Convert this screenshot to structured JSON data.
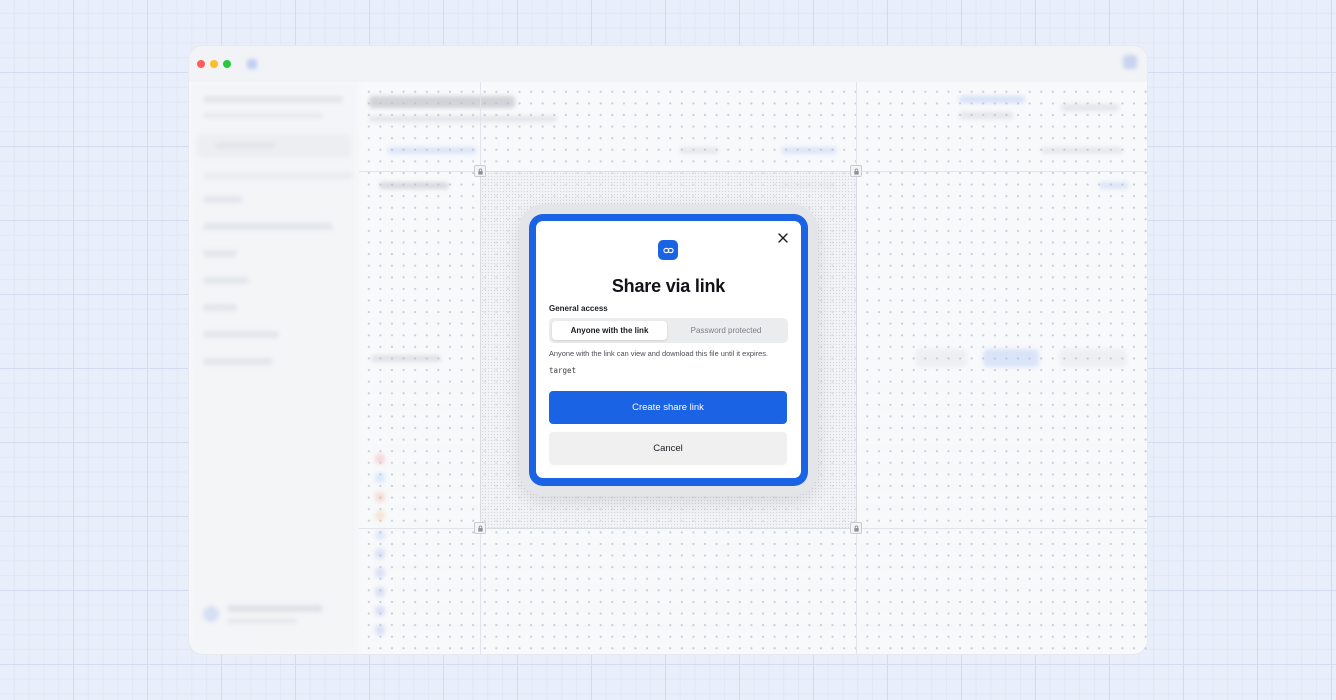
{
  "modal": {
    "title": "Share via link",
    "access_label": "General access",
    "options": [
      {
        "label": "Anyone with the link",
        "selected": true
      },
      {
        "label": "Password protected",
        "selected": false
      }
    ],
    "description": "Anyone with the link can view and download this file until it expires.",
    "target_text": "target",
    "primary_button": "Create share link",
    "secondary_button": "Cancel",
    "icons": {
      "header": "link-icon",
      "close": "close-icon"
    }
  },
  "colors": {
    "accent": "#1b63e5",
    "background": "#e9eefb",
    "modal_surface": "#ffffff",
    "secondary_button": "#f0f0f1"
  }
}
